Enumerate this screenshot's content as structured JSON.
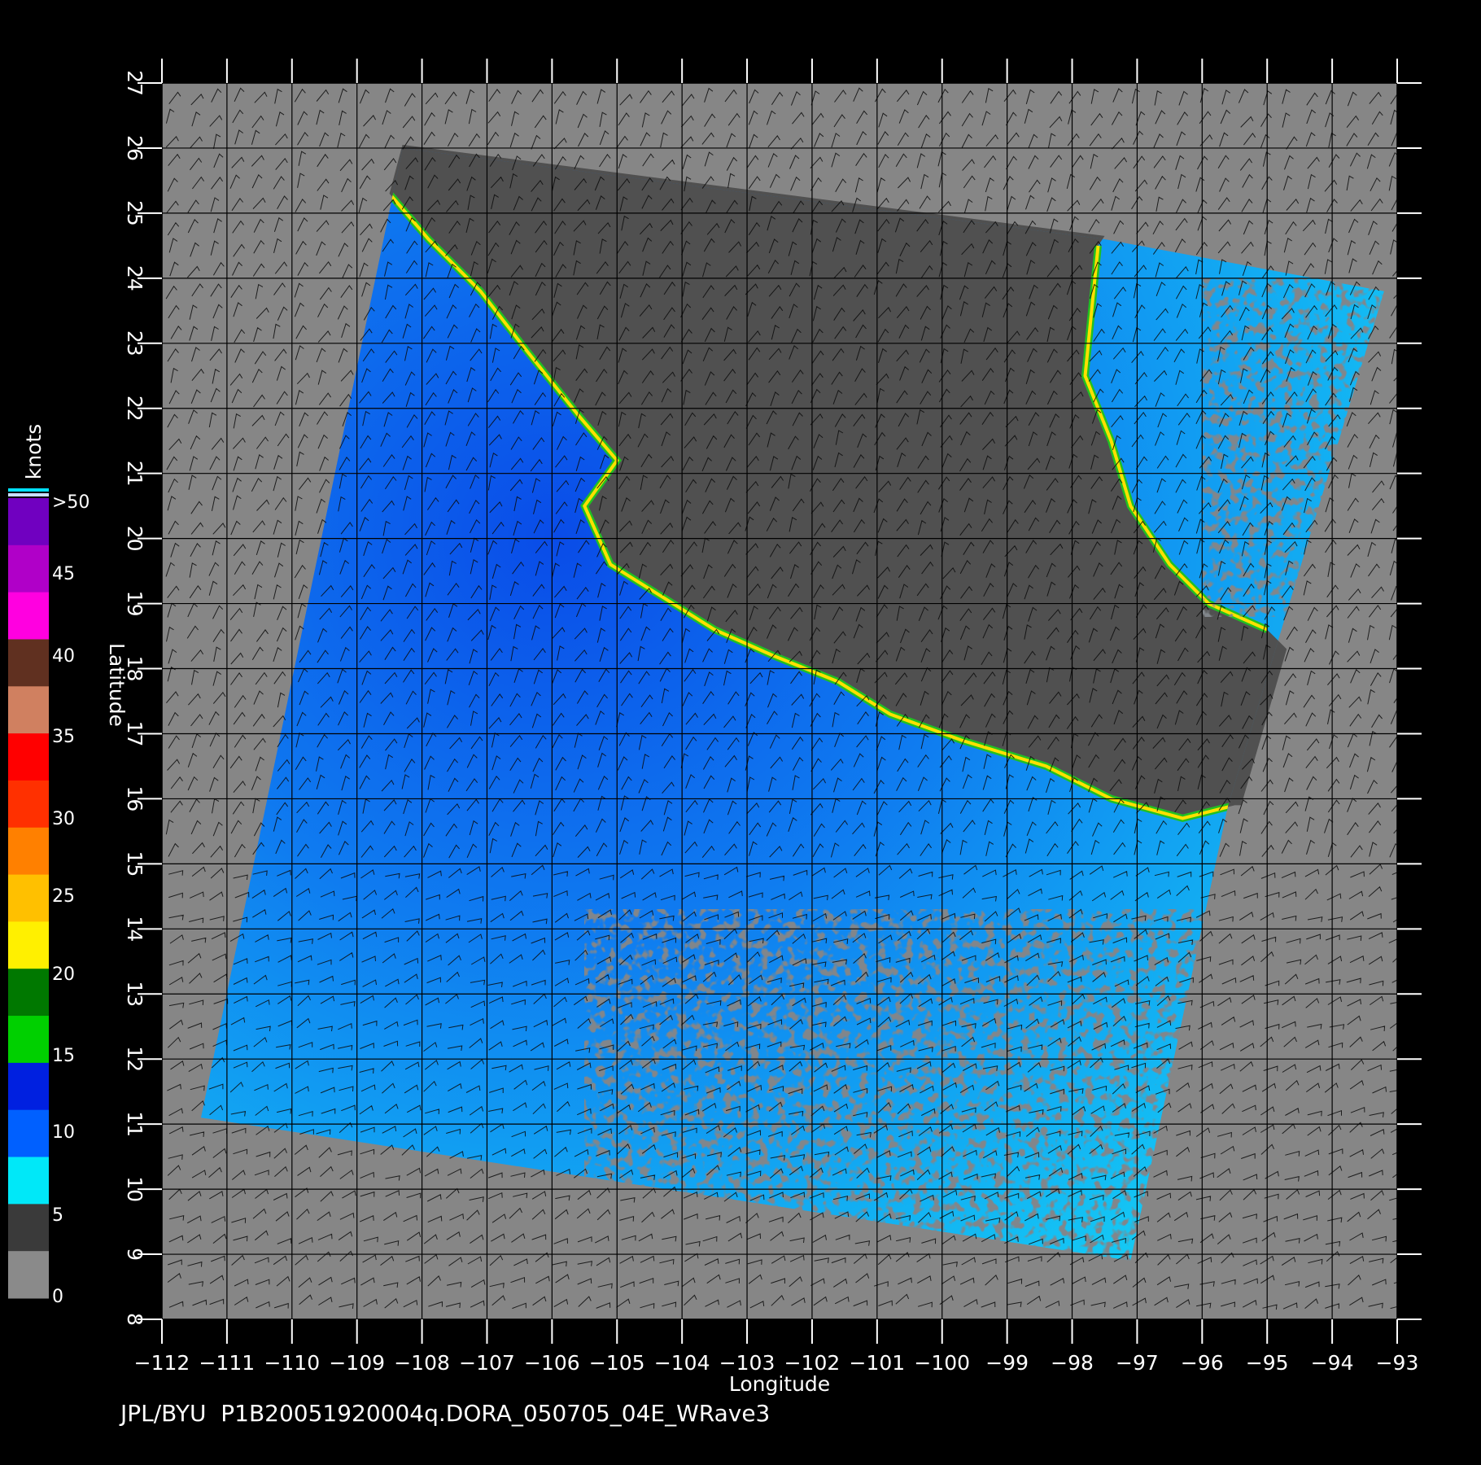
{
  "chart_data": {
    "type": "map",
    "xlabel": "Longitude",
    "ylabel": "Latitude",
    "xlim": [
      -112,
      -93
    ],
    "ylim": [
      8,
      27
    ],
    "x_ticks": [
      "-112",
      "-111",
      "-110",
      "-109",
      "-108",
      "-107",
      "-106",
      "-105",
      "-104",
      "-103",
      "-102",
      "-101",
      "-100",
      "-99",
      "-98",
      "-97",
      "-96",
      "-95",
      "-94",
      "-93"
    ],
    "y_ticks": [
      "8",
      "9",
      "10",
      "11",
      "12",
      "13",
      "14",
      "15",
      "16",
      "17",
      "18",
      "19",
      "20",
      "21",
      "22",
      "23",
      "24",
      "25",
      "26",
      "27"
    ],
    "grid": true,
    "colorbar": {
      "title": "knots",
      "labels": [
        "0",
        "5",
        "10",
        "15",
        "20",
        "25",
        "30",
        "35",
        "40",
        "45",
        ">50"
      ],
      "colors": [
        "#8a8a8a",
        "#3a3a3a",
        "#00e8f8",
        "#0060ff",
        "#0020e0",
        "#00d000",
        "#007800",
        "#fff000",
        "#ffc000",
        "#ff8000",
        "#ff3000",
        "#ff0000",
        "#d08060",
        "#603020",
        "#ff00e0",
        "#b000c8",
        "#7000c0"
      ]
    },
    "swath_corners_lonlat": [
      [
        -108.3,
        26.0
      ],
      [
        -97.5,
        24.6
      ],
      [
        -93.2,
        23.8
      ],
      [
        -95.6,
        15.9
      ],
      [
        -97.1,
        8.9
      ],
      [
        -111.4,
        11.1
      ]
    ],
    "coastline_lonlat": [
      [
        -108.5,
        25.3
      ],
      [
        -107.9,
        24.6
      ],
      [
        -107.1,
        23.8
      ],
      [
        -106.4,
        22.9
      ],
      [
        -105.6,
        21.9
      ],
      [
        -105.0,
        21.2
      ],
      [
        -105.5,
        20.5
      ],
      [
        -105.1,
        19.6
      ],
      [
        -104.3,
        19.1
      ],
      [
        -103.5,
        18.6
      ],
      [
        -102.6,
        18.2
      ],
      [
        -101.6,
        17.8
      ],
      [
        -100.8,
        17.3
      ],
      [
        -99.7,
        16.9
      ],
      [
        -98.4,
        16.5
      ],
      [
        -97.4,
        16.0
      ],
      [
        -96.3,
        15.7
      ],
      [
        -95.5,
        15.9
      ]
    ],
    "gulf_coast_lonlat": [
      [
        -97.6,
        24.5
      ],
      [
        -97.7,
        23.5
      ],
      [
        -97.8,
        22.5
      ],
      [
        -97.4,
        21.5
      ],
      [
        -97.1,
        20.5
      ],
      [
        -96.5,
        19.6
      ],
      [
        -95.9,
        19.0
      ],
      [
        -95.0,
        18.6
      ]
    ]
  },
  "footer": {
    "caption": "JPL/BYU  P1B20051920004q.DORA_050705_04E_WRave3"
  }
}
